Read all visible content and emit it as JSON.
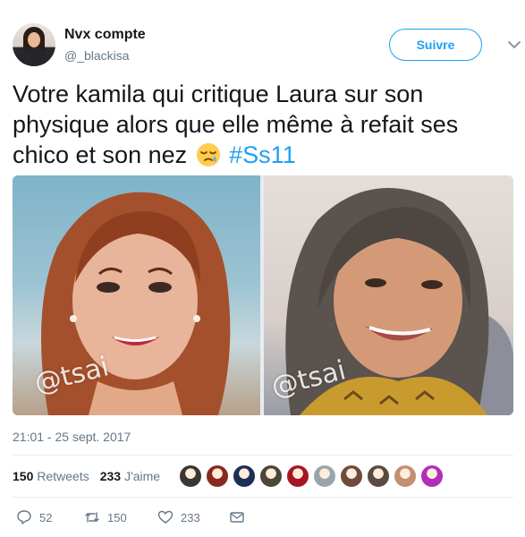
{
  "user": {
    "name": "Nvx compte",
    "handle": "@_blackisa"
  },
  "follow_label": "Suivre",
  "tweet": {
    "text": "Votre kamila qui critique Laura sur son physique alors que elle même à refait ses chico et son nez",
    "hashtag": "#Ss11",
    "emoji": "😪"
  },
  "media": {
    "watermark_left": "@tsai",
    "watermark_right": "@tsai"
  },
  "timestamp": "21:01 - 25 sept. 2017",
  "stats": {
    "retweets_count": "150",
    "retweets_label": "Retweets",
    "likes_count": "233",
    "likes_label": "J'aime"
  },
  "likers": [
    "#3a3632",
    "#8a2a1e",
    "#1c2f57",
    "#4f463a",
    "#a61622",
    "#9aa4ad",
    "#6e4b3a",
    "#5b4a3f",
    "#c48e72",
    "#b02fb8"
  ],
  "actions": {
    "reply_count": "52",
    "retweet_count": "150",
    "like_count": "233"
  },
  "colors": {
    "accent": "#1da1f2",
    "secondary_text": "#657786",
    "divider": "#e6ecf0"
  }
}
